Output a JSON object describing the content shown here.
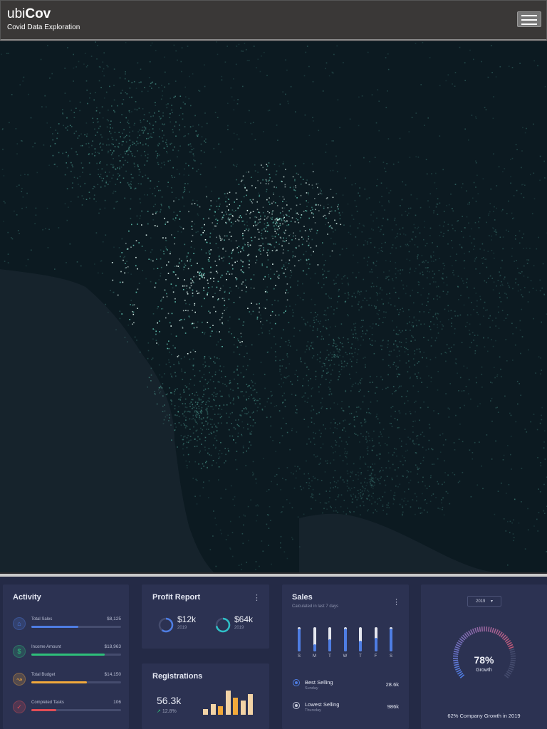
{
  "header": {
    "logo_light": "ubi",
    "logo_bold": "Cov",
    "subtitle": "Covid Data Exploration"
  },
  "activity": {
    "title": "Activity",
    "items": [
      {
        "label": "Total Sales",
        "value": "$8,125",
        "progress": 0.52,
        "color": "#4e7de3",
        "icon": "bag-icon"
      },
      {
        "label": "Income Amount",
        "value": "$18,963",
        "progress": 0.82,
        "color": "#2ec07a",
        "icon": "dollar-icon"
      },
      {
        "label": "Total Budget",
        "value": "$14,150",
        "progress": 0.62,
        "color": "#f2a93b",
        "icon": "trend-icon"
      },
      {
        "label": "Completed Tasks",
        "value": "106",
        "progress": 0.28,
        "color": "#e24d56",
        "icon": "check-icon"
      }
    ]
  },
  "profit": {
    "title": "Profit Report",
    "items": [
      {
        "value": "$12k",
        "year": "2019",
        "progress": 0.6,
        "color": "#4e7de3"
      },
      {
        "value": "$64k",
        "year": "2019",
        "progress": 0.72,
        "color": "#2ec0c7"
      }
    ]
  },
  "registrations": {
    "title": "Registrations",
    "value": "56.3k",
    "change": "12.8%",
    "bars": [
      {
        "level": 0.25,
        "color": "#f2d3a6"
      },
      {
        "level": 0.45,
        "color": "#f2d3a6"
      },
      {
        "level": 0.35,
        "color": "#f2a93b"
      },
      {
        "level": 1.0,
        "color": "#f2d3a6"
      },
      {
        "level": 0.7,
        "color": "#f2a93b"
      },
      {
        "level": 0.6,
        "color": "#f2d3a6"
      },
      {
        "level": 0.85,
        "color": "#f2d3a6"
      }
    ]
  },
  "sales": {
    "title": "Sales",
    "subtitle": "Calculated in last 7 days",
    "days": [
      {
        "label": "S",
        "level": 0.95
      },
      {
        "label": "M",
        "level": 0.3
      },
      {
        "label": "T",
        "level": 0.5
      },
      {
        "label": "W",
        "level": 0.95
      },
      {
        "label": "T",
        "level": 0.45
      },
      {
        "label": "F",
        "level": 0.55
      },
      {
        "label": "S",
        "level": 0.95
      }
    ],
    "best_label": "Best Selling",
    "best_day": "Sunday",
    "best_value": "28.6k",
    "lowest_label": "Lowest Selling",
    "lowest_day": "Thursday",
    "lowest_value": "986k"
  },
  "growth": {
    "year_select": "2019",
    "percent": "78%",
    "percent_value": 0.78,
    "label": "Growth",
    "footer": "62% Company Growth in 2019"
  }
}
